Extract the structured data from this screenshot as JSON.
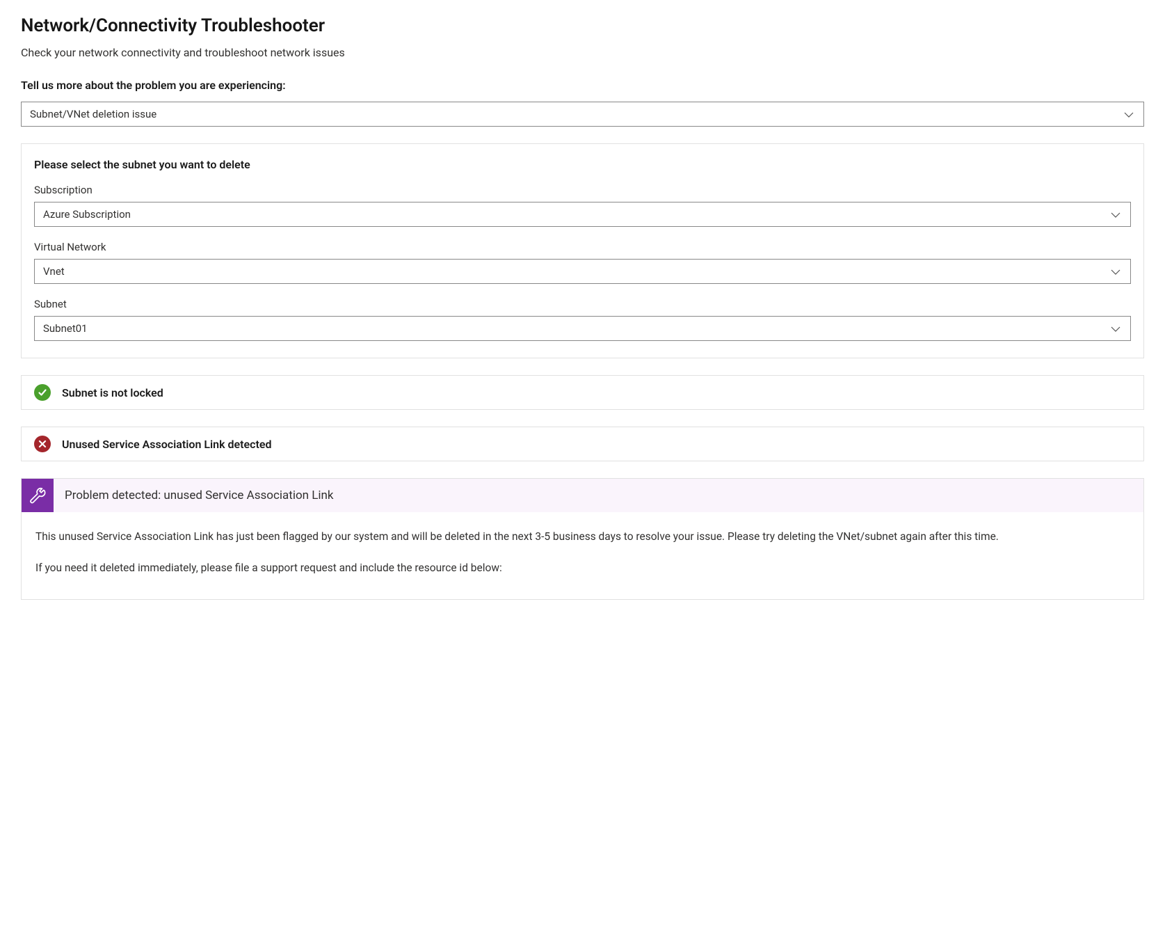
{
  "header": {
    "title": "Network/Connectivity Troubleshooter",
    "subtitle": "Check your network connectivity and troubleshoot network issues"
  },
  "problemPrompt": {
    "label": "Tell us more about the problem you are experiencing:",
    "selected": "Subnet/VNet deletion issue"
  },
  "selectionPanel": {
    "heading": "Please select the subnet you want to delete",
    "fields": {
      "subscription": {
        "label": "Subscription",
        "value": "Azure Subscription"
      },
      "virtualNetwork": {
        "label": "Virtual Network",
        "value": "Vnet"
      },
      "subnet": {
        "label": "Subnet",
        "value": "Subnet01"
      }
    }
  },
  "statuses": {
    "locked": {
      "text": "Subnet is not locked"
    },
    "salDetected": {
      "text": "Unused Service Association Link detected"
    }
  },
  "problemDetail": {
    "title": "Problem detected: unused Service Association Link",
    "para1": "This unused Service Association Link has just been flagged by our system and will be deleted in the next 3-5 business days to resolve your issue. Please try deleting the VNet/subnet again after this time.",
    "para2": "If you need it deleted immediately, please file a support request and include the resource id below:"
  }
}
